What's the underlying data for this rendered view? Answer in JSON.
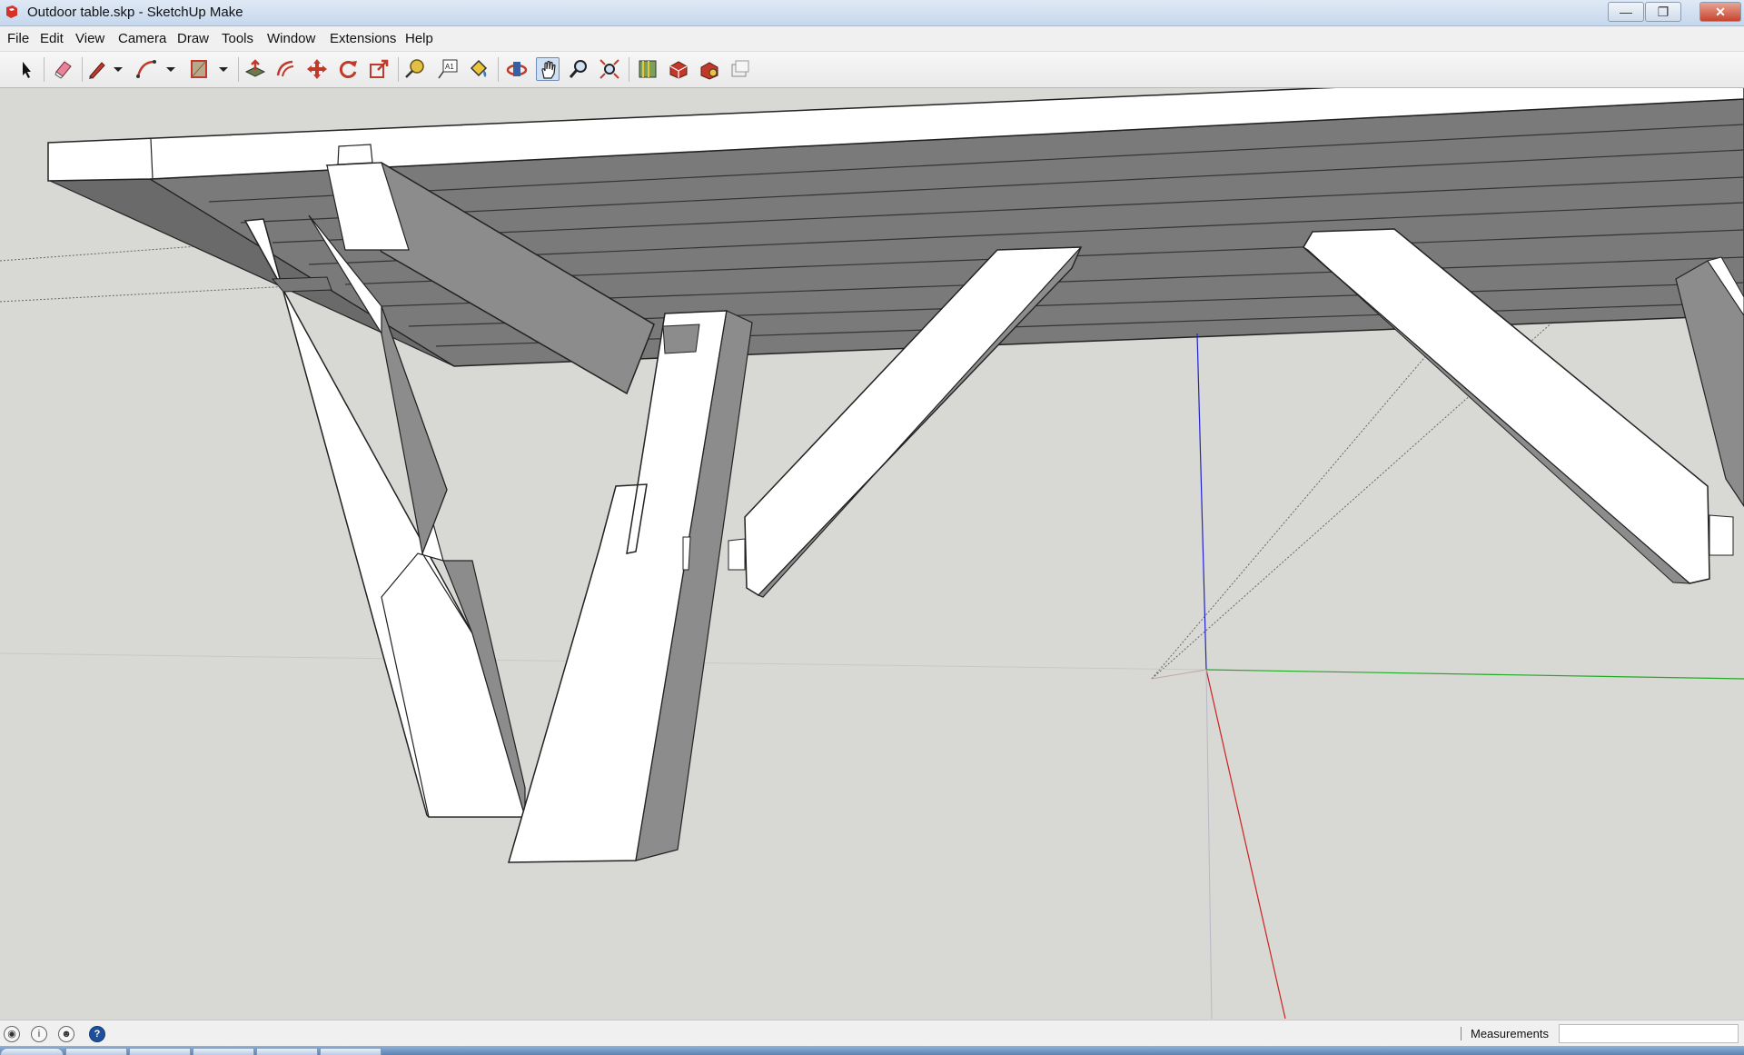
{
  "window": {
    "title": "Outdoor table.skp - SketchUp Make",
    "minimize_icon": "minimize-icon",
    "restore_icon": "restore-icon",
    "close_icon": "close-icon"
  },
  "menu": {
    "items": [
      "File",
      "Edit",
      "View",
      "Camera",
      "Draw",
      "Tools",
      "Window",
      "Extensions",
      "Help"
    ]
  },
  "toolbar": {
    "tools": [
      {
        "name": "select-icon",
        "active": false
      },
      {
        "name": "eraser-icon",
        "active": false
      },
      {
        "name": "line-pencil-icon",
        "active": false
      },
      {
        "name": "arc-icon",
        "active": false
      },
      {
        "name": "rectangle-icon",
        "active": false
      },
      {
        "name": "push-pull-icon",
        "active": false
      },
      {
        "name": "offset-icon",
        "active": false
      },
      {
        "name": "move-icon",
        "active": false
      },
      {
        "name": "rotate-icon",
        "active": false
      },
      {
        "name": "scale-icon",
        "active": false
      },
      {
        "name": "tape-measure-icon",
        "active": false
      },
      {
        "name": "text-icon",
        "active": false
      },
      {
        "name": "paint-bucket-icon",
        "active": false
      },
      {
        "name": "orbit-icon",
        "active": false
      },
      {
        "name": "pan-icon",
        "active": true
      },
      {
        "name": "zoom-icon",
        "active": false
      },
      {
        "name": "zoom-extents-icon",
        "active": false
      },
      {
        "name": "add-location-icon",
        "active": false
      },
      {
        "name": "3d-warehouse-icon",
        "active": false
      },
      {
        "name": "extension-warehouse-icon",
        "active": false
      },
      {
        "name": "layout-icon",
        "active": false
      }
    ]
  },
  "colors": {
    "background": "#d8d8d4",
    "top_face": "#ffffff",
    "side_face": "#8a8a8a",
    "underside": "#7a7a7a",
    "axis_red": "#cc2222",
    "axis_green": "#22aa22",
    "axis_blue": "#2222cc"
  },
  "statusbar": {
    "measurements_label": "Measurements",
    "measurements_value": "",
    "icons": [
      "geo-location-icon",
      "credits-icon",
      "user-icon",
      "help-icon"
    ],
    "help_glyph": "?"
  }
}
